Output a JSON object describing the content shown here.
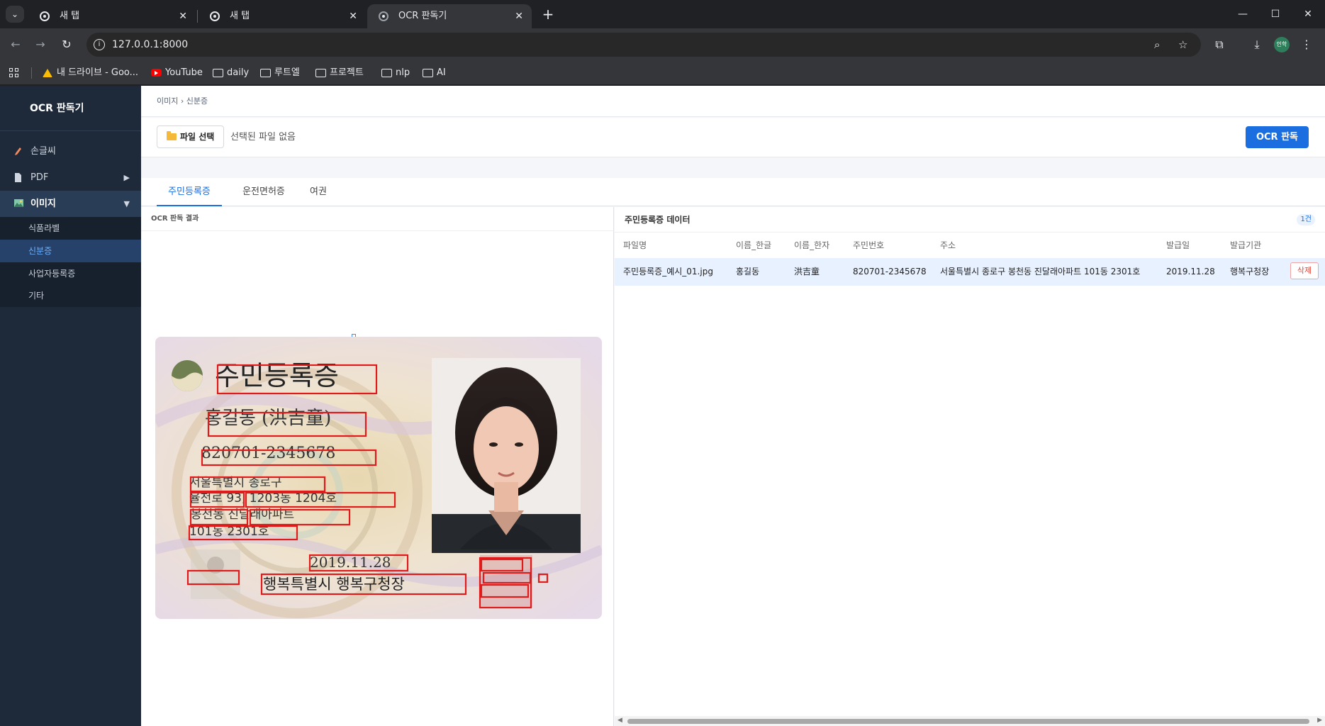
{
  "browser": {
    "tabs": [
      {
        "title": "새 탭"
      },
      {
        "title": "새 탭"
      },
      {
        "title": "OCR 판독기"
      }
    ],
    "url": "127.0.0.1:8000",
    "profile_label": "인학",
    "bookmarks": [
      "내 드라이브 - Goo...",
      "YouTube",
      "daily",
      "루트엘",
      "프로젝트",
      "nlp",
      "AI"
    ]
  },
  "sidebar": {
    "brand": "OCR 판독기",
    "items": [
      {
        "label": "손글씨",
        "icon": "pencil-icon"
      },
      {
        "label": "PDF",
        "icon": "document-icon"
      },
      {
        "label": "이미지",
        "icon": "image-icon"
      }
    ],
    "sub_items": [
      "식품라벨",
      "신분증",
      "사업자등록증",
      "기타"
    ]
  },
  "breadcrumb": "이미지 › 신분증",
  "upload": {
    "file_button": "파일 선택",
    "no_file": "선택된 파일 없음",
    "ocr_button": "OCR 판독"
  },
  "doc_tabs": [
    "주민등록증",
    "운전면허증",
    "여권"
  ],
  "left_panel": {
    "title": "OCR 판독 결과",
    "card": {
      "heading": "주민등록증",
      "name": "홍길동 (洪吉童)",
      "rrn": "820701-2345678",
      "address_lines": [
        "서울특별시 종로구",
        "율천로 93, 1203동 1204호",
        "봉천동 진달래아파트",
        "101동 2301호"
      ],
      "date": "2019.11.28",
      "issuer": "행복특별시 행복구청장"
    }
  },
  "right_panel": {
    "title": "주민등록증 데이터",
    "count": "1건",
    "columns": [
      "파일명",
      "이름_한글",
      "이름_한자",
      "주민번호",
      "주소",
      "발급일",
      "발급기관"
    ],
    "rows": [
      {
        "file": "주민등록증_예시_01.jpg",
        "name_ko": "홍길동",
        "name_hanja": "洪吉童",
        "rrn": "820701-2345678",
        "address": "서울특별시 종로구 봉천동 진달래아파트 101동 2301호",
        "date": "2019.11.28",
        "issuer": "행복구청장"
      }
    ],
    "delete_label": "삭제"
  },
  "colors": {
    "accent": "#1a6ee0",
    "sidebar_bg": "#1e2a3a",
    "ocr_box": "#e01b1b",
    "delete": "#e0483e"
  }
}
